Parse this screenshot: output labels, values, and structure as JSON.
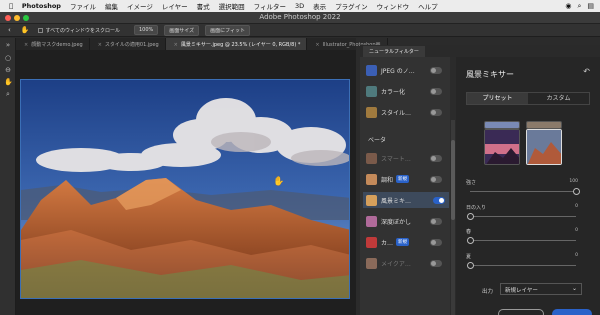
{
  "menubar": {
    "app": "Photoshop",
    "items": [
      "ファイル",
      "編集",
      "イメージ",
      "レイヤー",
      "書式",
      "選択範囲",
      "フィルター",
      "3D",
      "表示",
      "プラグイン",
      "ウィンドウ",
      "ヘルプ"
    ]
  },
  "window": {
    "title": "Adobe Photoshop 2022"
  },
  "options": {
    "scroll_all": "すべてのウィンドウをスクロール",
    "zoom_100": "100%",
    "fit_screen": "画面サイズ",
    "fill_screen": "画面にフィット"
  },
  "tabs": [
    {
      "label": "顔動マスクdemo.jpeg"
    },
    {
      "label": "スタイルの適用01.jpeg"
    },
    {
      "label": "風景ミキサー.jpeg @ 23.5% (レイヤー 0, RGB/8) *"
    },
    {
      "label": "Illustrator_Photoshop画"
    }
  ],
  "neural_filters": {
    "tab": "ニューラルフィルター",
    "beta_label": "ベータ",
    "new_badge": "新規",
    "items": [
      {
        "label": "JPEG のノ…"
      },
      {
        "label": "カラー化"
      },
      {
        "label": "スタイル…"
      },
      {
        "label": "スマート…"
      },
      {
        "label": "調和"
      },
      {
        "label": "風景ミキ…"
      },
      {
        "label": "深度ぼかし"
      },
      {
        "label": "カ…"
      },
      {
        "label": "メイクア…"
      }
    ]
  },
  "settings": {
    "title": "風景ミキサー",
    "preset_tab": "プリセット",
    "custom_tab": "カスタム",
    "sliders": [
      {
        "label": "強さ",
        "value": "100",
        "level": 1.0
      },
      {
        "label": "日の入り",
        "value": "0",
        "level": 0.0
      },
      {
        "label": "春",
        "value": "0",
        "level": 0.0
      },
      {
        "label": "夏",
        "value": "0",
        "level": 0.0
      }
    ],
    "output_label": "出力",
    "output_value": "新規レイヤー"
  },
  "colors": {
    "accent": "#2a62c9",
    "canvas_bg": "#1f1f1f",
    "panel_bg": "#262626"
  }
}
